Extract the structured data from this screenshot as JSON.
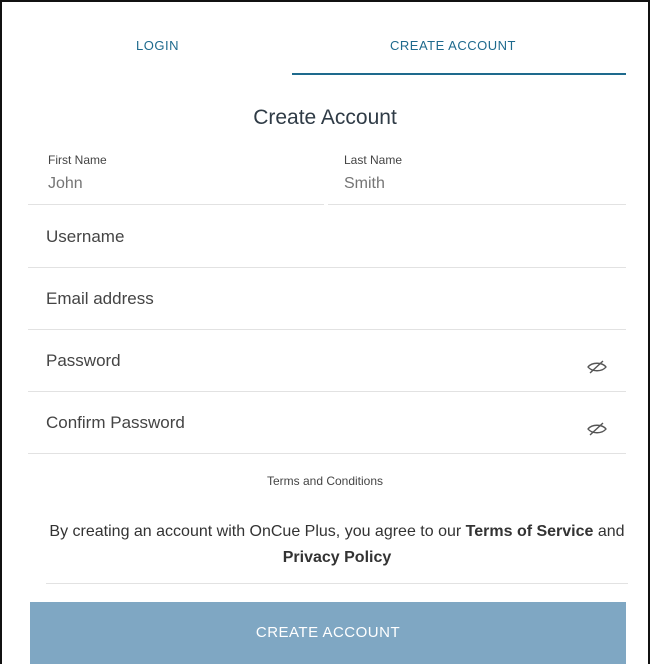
{
  "tabs": {
    "login": "LOGIN",
    "create_account": "CREATE ACCOUNT",
    "active": "create_account"
  },
  "form": {
    "title": "Create Account",
    "first_name": {
      "label": "First Name",
      "placeholder": "John"
    },
    "last_name": {
      "label": "Last Name",
      "placeholder": "Smith"
    },
    "username": {
      "label": "Username"
    },
    "email": {
      "label": "Email address"
    },
    "password": {
      "label": "Password",
      "toggle_icon": "eye-slash-icon"
    },
    "confirm_password": {
      "label": "Confirm Password",
      "toggle_icon": "eye-slash-icon"
    }
  },
  "terms": {
    "heading": "Terms and Conditions",
    "text_prefix": "By creating an account with OnCue Plus, you agree to our ",
    "terms_link": "Terms of Service",
    "text_mid": " and ",
    "privacy_link": "Privacy Policy"
  },
  "submit_label": "CREATE ACCOUNT",
  "colors": {
    "accent": "#1e6a8d",
    "button_bg": "#7fa7c3",
    "divider": "#e2e2e2",
    "placeholder": "#a9a9a9"
  }
}
